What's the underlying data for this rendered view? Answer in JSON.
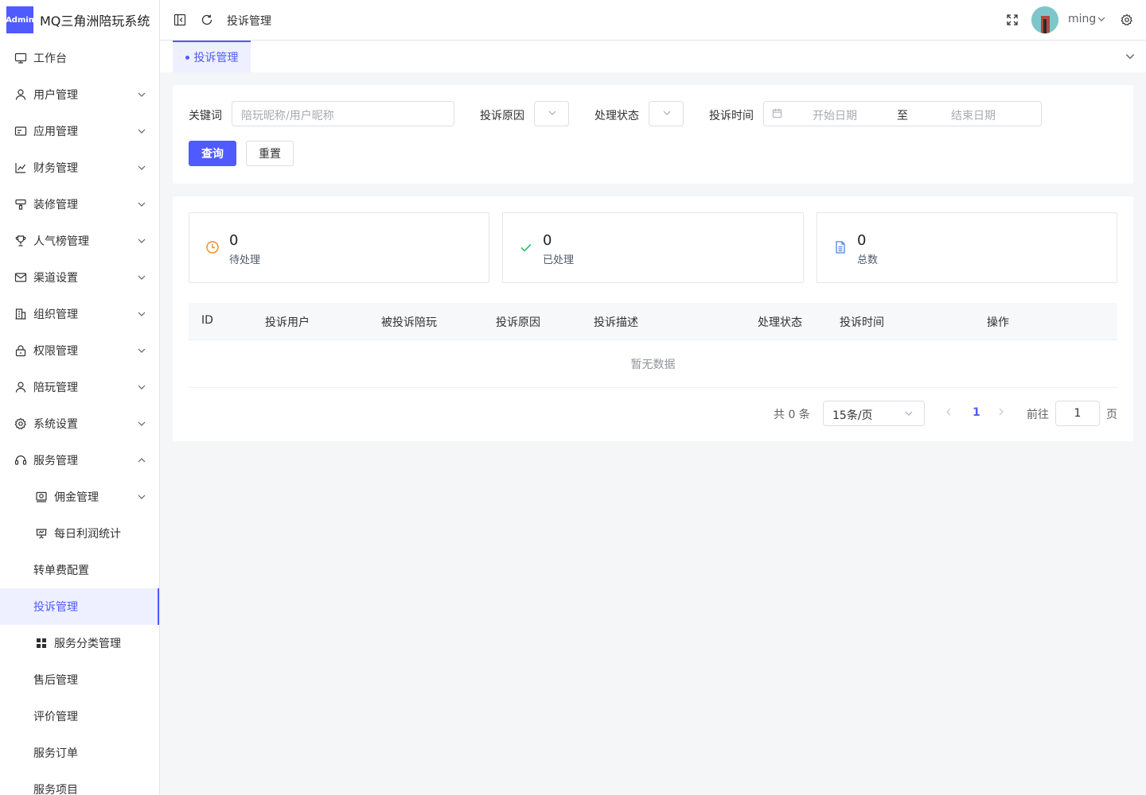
{
  "app": {
    "badge": "Admin",
    "title": "MQ三角洲陪玩系统"
  },
  "sidebar": {
    "items": [
      {
        "label": "工作台"
      },
      {
        "label": "用户管理"
      },
      {
        "label": "应用管理"
      },
      {
        "label": "财务管理"
      },
      {
        "label": "装修管理"
      },
      {
        "label": "人气榜管理"
      },
      {
        "label": "渠道设置"
      },
      {
        "label": "组织管理"
      },
      {
        "label": "权限管理"
      },
      {
        "label": "陪玩管理"
      },
      {
        "label": "系统设置"
      },
      {
        "label": "服务管理"
      },
      {
        "label": "佣金管理"
      },
      {
        "label": "每日利润统计"
      },
      {
        "label": "转单费配置"
      },
      {
        "label": "投诉管理"
      },
      {
        "label": "服务分类管理"
      },
      {
        "label": "售后管理"
      },
      {
        "label": "评价管理"
      },
      {
        "label": "服务订单"
      },
      {
        "label": "服务项目"
      }
    ]
  },
  "header": {
    "breadcrumb": "投诉管理",
    "username": "ming"
  },
  "tabs": [
    {
      "label": "投诉管理"
    }
  ],
  "filters": {
    "keyword_label": "关键词",
    "keyword_placeholder": "陪玩昵称/用户昵称",
    "reason_label": "投诉原因",
    "status_label": "处理状态",
    "time_label": "投诉时间",
    "start_placeholder": "开始日期",
    "range_sep": "至",
    "end_placeholder": "结束日期",
    "query_button": "查询",
    "reset_button": "重置"
  },
  "stats": [
    {
      "value": "0",
      "label": "待处理",
      "color": "#f08a24"
    },
    {
      "value": "0",
      "label": "已处理",
      "color": "#2ec26a"
    },
    {
      "value": "0",
      "label": "总数",
      "color": "#4a86e8"
    }
  ],
  "table": {
    "columns": [
      "ID",
      "投诉用户",
      "被投诉陪玩",
      "投诉原因",
      "投诉描述",
      "处理状态",
      "投诉时间",
      "操作"
    ],
    "empty_text": "暂无数据"
  },
  "pagination": {
    "total_text": "共 0 条",
    "page_size": "15条/页",
    "current_page": "1",
    "goto_label": "前往",
    "goto_value": "1",
    "page_suffix": "页"
  },
  "colors": {
    "primary": "#4f5bff"
  }
}
